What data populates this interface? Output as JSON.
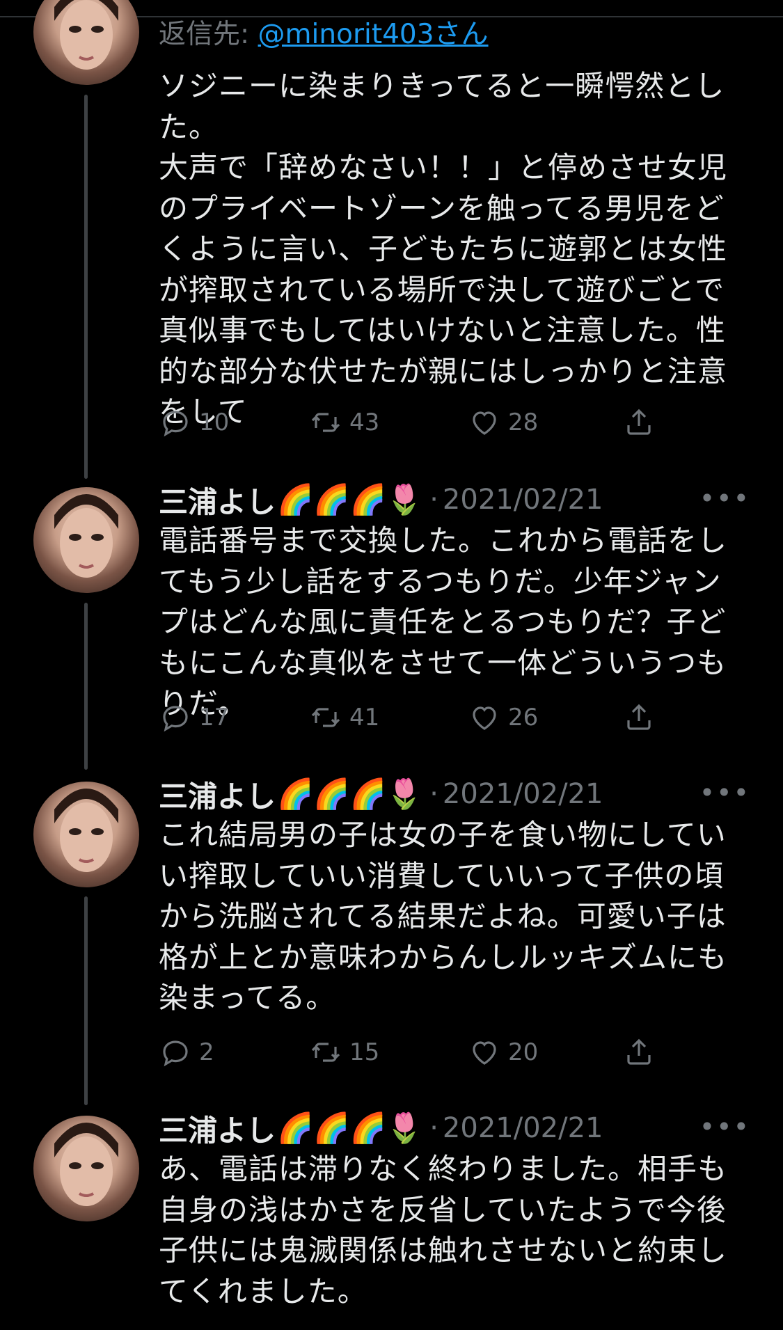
{
  "reply_context": {
    "prefix": "返信先: ",
    "handle": "@minorit403さん"
  },
  "tweets": [
    {
      "text": "ソジニーに染まりきってると一瞬愕然とした。\n大声で「辞めなさい！！」と停めさせ女児のプライベートゾーンを触ってる男児をどくように言い、子どもたちに遊郭とは女性が搾取されている場所で決して遊びごとで真似事でもしてはいけないと注意した。性的な部分な伏せたが親にはしっかりと注意をして",
      "replies": "10",
      "retweets": "43",
      "likes": "28"
    },
    {
      "author": "三浦よし",
      "emojis": "🌈🌈🌈🌷",
      "separator": "·",
      "date": "2021/02/21",
      "text": "電話番号まで交換した。これから電話をしてもう少し話をするつもりだ。少年ジャンプはどんな風に責任をとるつもりだ？子どもにこんな真似をさせて一体どういうつもりだ。",
      "replies": "17",
      "retweets": "41",
      "likes": "26"
    },
    {
      "author": "三浦よし",
      "emojis": "🌈🌈🌈🌷",
      "separator": "·",
      "date": "2021/02/21",
      "text": "これ結局男の子は女の子を食い物にしていい搾取していい消費していいって子供の頃から洗脳されてる結果だよね。可愛い子は格が上とか意味わからんしルッキズムにも染まってる。",
      "replies": "2",
      "retweets": "15",
      "likes": "20"
    },
    {
      "author": "三浦よし",
      "emojis": "🌈🌈🌈🌷",
      "separator": "·",
      "date": "2021/02/21",
      "text": "あ、電話は滞りなく終わりました。相手も自身の浅はかさを反省していたようで今後子供には鬼滅関係は触れさせないと約束してくれました。"
    }
  ],
  "icons": {
    "reply": "reply-icon",
    "retweet": "retweet-icon",
    "like": "heart-icon",
    "share": "share-icon",
    "more": "more-icon"
  },
  "colors": {
    "background": "#000000",
    "text": "#e7e9ea",
    "muted": "#71767b",
    "link": "#1d9bf0",
    "thread_line": "#3e4144"
  }
}
